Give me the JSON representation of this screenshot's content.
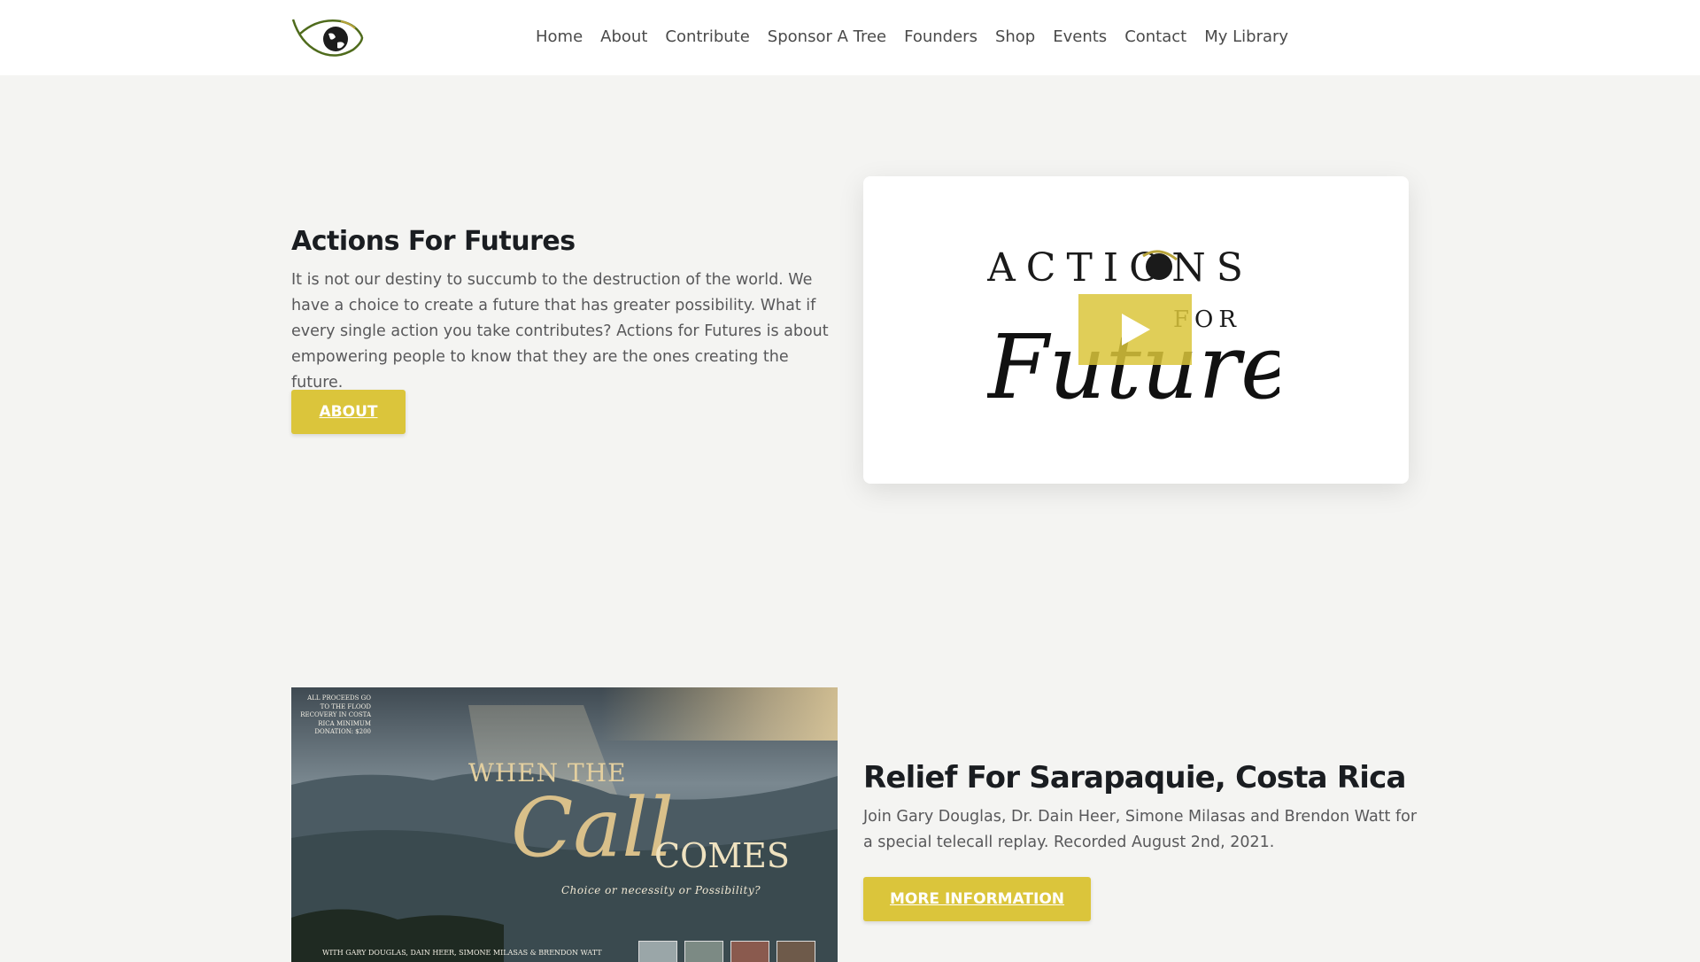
{
  "nav": {
    "items": [
      {
        "label": "Home"
      },
      {
        "label": "About"
      },
      {
        "label": "Contribute"
      },
      {
        "label": "Sponsor A Tree"
      },
      {
        "label": "Founders"
      },
      {
        "label": "Shop"
      },
      {
        "label": "Events"
      },
      {
        "label": "Contact"
      },
      {
        "label": "My Library"
      }
    ]
  },
  "hero": {
    "title": "Actions For Futures",
    "text": "It is not our destiny to succumb to the destruction of the world. We have a  choice to create a future that has greater possibility. What if every single action you take contributes? Actions for Futures is about empowering people to know that they are the ones creating the future.",
    "button_label": "ABOUT",
    "video_logo": {
      "line1": "ACTIONS",
      "line2": "FOR",
      "line3": "Futures"
    }
  },
  "relief": {
    "title": "Relief For Sarapaquie, Costa Rica",
    "text": "Join Gary Douglas, Dr. Dain Heer, Simone Milasas and Brendon Watt for a special telecall replay. Recorded August 2nd, 2021.",
    "button_label": "MORE INFORMATION",
    "promo": {
      "small_text": "All proceeds go to the flood recovery in Costa Rica Minimum Donation: $200",
      "when_the": "WHEN THE",
      "call": "Call",
      "comes": "COMES",
      "subtitle": "Choice or necessity or Possibility?",
      "bottom": "With Gary Douglas, Dain Heer, Simone Milasas & Brendon Watt"
    }
  },
  "colors": {
    "accent": "#dbc53b",
    "heading": "#1a1d21",
    "body_text": "#58585a",
    "background": "#f4f4f2",
    "logo_green": "#4f6b1c"
  }
}
